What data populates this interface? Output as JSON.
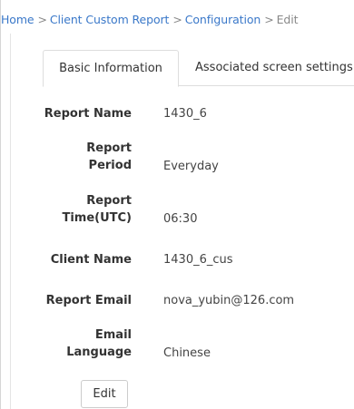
{
  "breadcrumb": {
    "items": [
      "Home",
      "Client Custom Report",
      "Configuration",
      "Edit"
    ],
    "separator": ">"
  },
  "tabs": [
    {
      "label": "Basic Information",
      "active": true
    },
    {
      "label": "Associated screen settings",
      "active": false
    }
  ],
  "fields": {
    "report_name": {
      "label_line1": "Report Name",
      "value": "1430_6"
    },
    "report_period": {
      "label_line1": "Report",
      "label_line2": "Period",
      "value": "Everyday"
    },
    "report_time": {
      "label_line1": "Report",
      "label_line2": "Time(UTC)",
      "value": "06:30"
    },
    "client_name": {
      "label_line1": "Client Name",
      "value": "1430_6_cus"
    },
    "report_email": {
      "label_line1": "Report Email",
      "value": "nova_yubin@126.com"
    },
    "email_language": {
      "label_line1": "Email",
      "label_line2": "Language",
      "value": "Chinese"
    }
  },
  "actions": {
    "edit_label": "Edit"
  },
  "colors": {
    "link": "#3a78c9",
    "muted": "#888888",
    "border": "#dddddd"
  }
}
